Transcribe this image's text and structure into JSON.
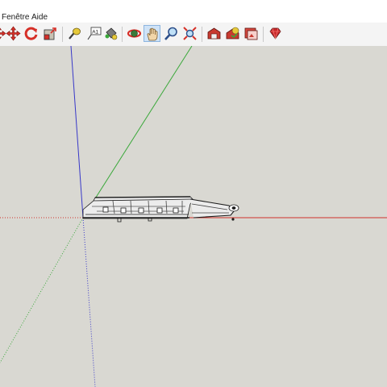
{
  "menubar": {
    "items": [
      {
        "id": "fenetre",
        "label": "Fenêtre"
      },
      {
        "id": "aide",
        "label": "Aide"
      }
    ]
  },
  "toolbar": {
    "buttons": [
      {
        "id": "move",
        "icon": "move-icon"
      },
      {
        "id": "rotate",
        "icon": "rotate-icon"
      },
      {
        "id": "scale",
        "icon": "scale-icon"
      },
      {
        "id": "tape-measure",
        "icon": "tape-measure-icon"
      },
      {
        "id": "text",
        "icon": "text-icon",
        "label": "A1"
      },
      {
        "id": "paint-bucket",
        "icon": "paint-bucket-icon"
      },
      {
        "id": "orbit",
        "icon": "orbit-icon"
      },
      {
        "id": "pan",
        "icon": "pan-hand-icon",
        "active": true
      },
      {
        "id": "zoom",
        "icon": "zoom-icon"
      },
      {
        "id": "zoom-extents",
        "icon": "zoom-extents-icon"
      },
      {
        "id": "warehouse",
        "icon": "3d-warehouse-icon"
      },
      {
        "id": "share-model",
        "icon": "share-model-icon"
      },
      {
        "id": "get-photo-texture",
        "icon": "photo-texture-icon"
      },
      {
        "id": "extension-warehouse",
        "icon": "ruby-gem-icon"
      }
    ]
  },
  "colors": {
    "viewport_bg": "#d9d8d2",
    "axis_red": "#d0302a",
    "axis_green": "#3aa83a",
    "axis_blue": "#3838c8",
    "active_button": "#cfe3f7"
  }
}
